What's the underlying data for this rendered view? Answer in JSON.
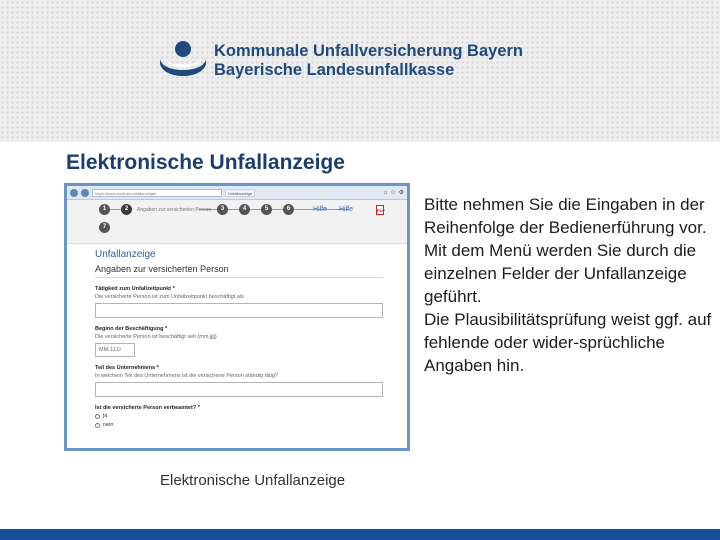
{
  "header": {
    "logo_line1": "Kommunale Unfallversicherung Bayern",
    "logo_line2": "Bayerische Landesunfallkasse"
  },
  "slide": {
    "title": "Elektronische Unfallanzeige",
    "caption": "Elektronische Unfallanzeige",
    "paragraphs": [
      "Bitte nehmen Sie die Eingaben in der Reihenfolge der Bedienerführung vor.",
      "Mit dem Menü werden Sie durch die einzelnen Felder der Unfallanzeige geführt.",
      "Die Plausibilitätsprüfung weist ggf. auf fehlende oder wider-sprüchliche Angaben hin."
    ]
  },
  "browser": {
    "url": "https://www.kuvb.de/unfallanzeige/",
    "tab": "Unfallanzeige"
  },
  "wizard": {
    "steps": [
      "1",
      "2",
      "3",
      "4",
      "5",
      "6",
      "7"
    ],
    "current_step_label": "Angaben zur versicherten Person",
    "menu_items": [
      "Hilfe",
      "Hilfe"
    ]
  },
  "form": {
    "title": "Unfallanzeige",
    "subtitle": "Angaben zur versicherten Person",
    "fields": [
      {
        "label": "Tätigkeit zum Unfallzeitpunkt *",
        "help": "Die versicherte Person ist zum Unfallzeitpunkt beschäftigt als"
      },
      {
        "label": "Beginn der Beschäftigung *",
        "help": "Die versicherte Person ist beschäftigt seit (mm.jjjj)",
        "placeholder": "MM.JJJJ"
      },
      {
        "label": "Teil des Unternehmens *",
        "help": "In welchem Teil des Unternehmens ist die versicherte Person ständig tätig?"
      },
      {
        "label": "Ist die versicherte Person verbeamtet? *",
        "options": [
          "ja",
          "nein"
        ]
      }
    ]
  },
  "colors": {
    "brand_blue": "#1f4a7d",
    "footer_blue": "#154f95",
    "frame_blue": "#6a95c5"
  }
}
